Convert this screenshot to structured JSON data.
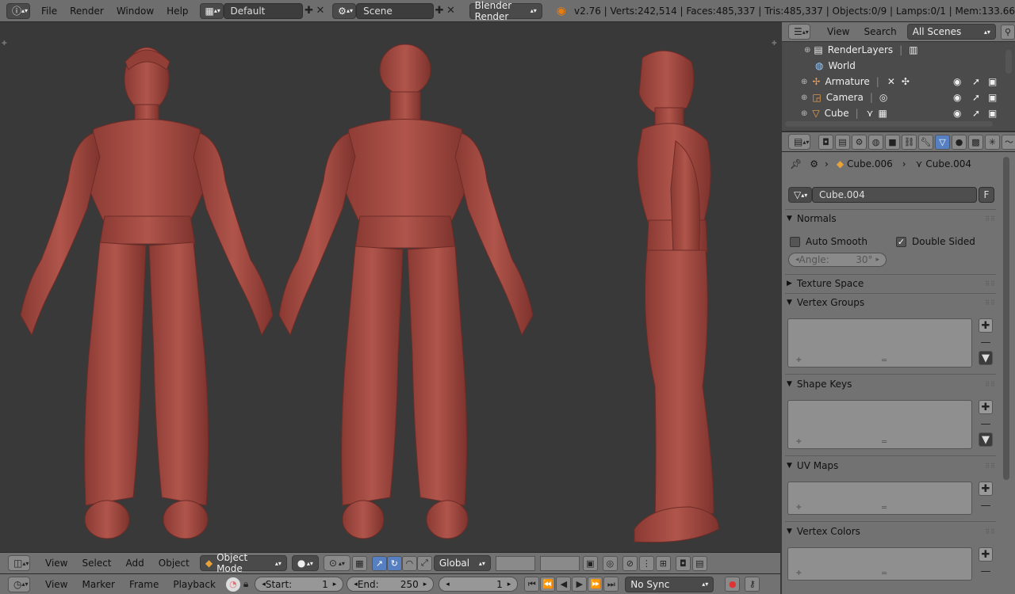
{
  "topbar": {
    "menus": [
      "File",
      "Render",
      "Window",
      "Help"
    ],
    "screen_layout": "Default",
    "scene": "Scene",
    "render_engine": "Blender Render",
    "stats": "v2.76 | Verts:242,514 | Faces:485,337 | Tris:485,337 | Objects:0/9 | Lamps:0/1 | Mem:133.66"
  },
  "viewport_header": {
    "menus": [
      "View",
      "Select",
      "Add",
      "Object"
    ],
    "mode": "Object Mode",
    "orientation": "Global"
  },
  "timeline_header": {
    "menus": [
      "View",
      "Marker",
      "Frame",
      "Playback"
    ],
    "start_label": "Start:",
    "start_value": "1",
    "end_label": "End:",
    "end_value": "250",
    "current_frame": "1",
    "sync": "No Sync"
  },
  "outliner": {
    "menus": [
      "View",
      "Search"
    ],
    "filter": "All Scenes",
    "rows": [
      "RenderLayers",
      "World",
      "Armature",
      "Camera",
      "Cube"
    ]
  },
  "properties": {
    "breadcrumb_object": "Cube.006",
    "breadcrumb_mesh": "Cube.004",
    "mesh_name": "Cube.004",
    "fake_user": "F",
    "normals_title": "Normals",
    "auto_smooth": "Auto Smooth",
    "double_sided": "Double Sided",
    "angle_label": "Angle:",
    "angle_value": "30°",
    "texture_space": "Texture Space",
    "vertex_groups": "Vertex Groups",
    "shape_keys": "Shape Keys",
    "uv_maps": "UV Maps",
    "vertex_colors": "Vertex Colors"
  },
  "colors": {
    "model": "#a0473f",
    "viewport_bg": "#393939",
    "header_bg": "#727272",
    "active_blue": "#5680c2"
  }
}
